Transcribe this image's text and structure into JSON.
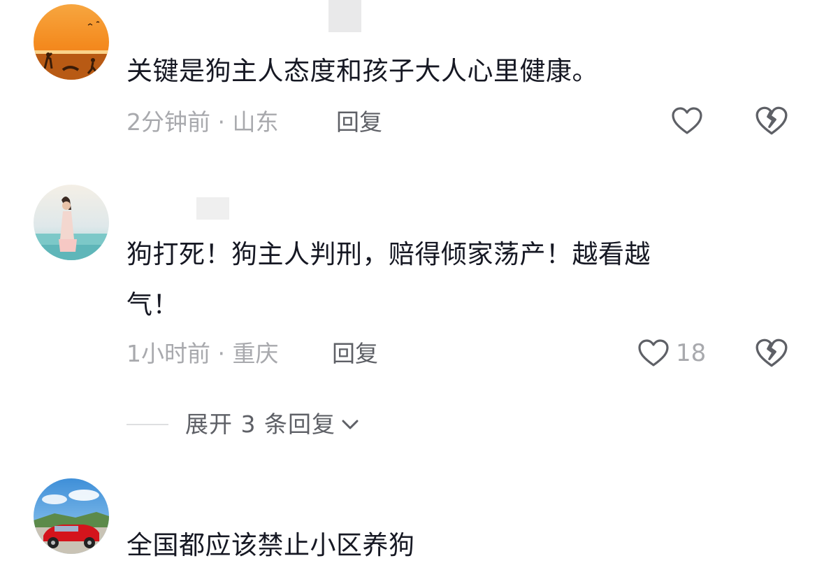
{
  "comments": [
    {
      "text_lines": [
        "关键是狗主人态度和孩子大人心里健康。"
      ],
      "time": "2分钟前",
      "location": "山东",
      "meta_separator": " · ",
      "reply_label": "回复",
      "like_count": ""
    },
    {
      "text_lines": [
        "狗打死！狗主人判刑，赔得倾家荡产！越看越",
        "气！"
      ],
      "time": "1小时前",
      "location": "重庆",
      "meta_separator": " · ",
      "reply_label": "回复",
      "like_count": "18",
      "expand_label": "展开 3 条回复"
    },
    {
      "text_lines": [
        "全国都应该禁止小区养狗"
      ]
    }
  ],
  "icons": {
    "like": "heart-outline-icon",
    "dislike": "broken-heart-icon",
    "expand": "chevron-down-icon"
  },
  "colors": {
    "text": "#161823",
    "meta": "#a8a9ad",
    "reply": "#5e6066",
    "icon": "#5e6066"
  }
}
